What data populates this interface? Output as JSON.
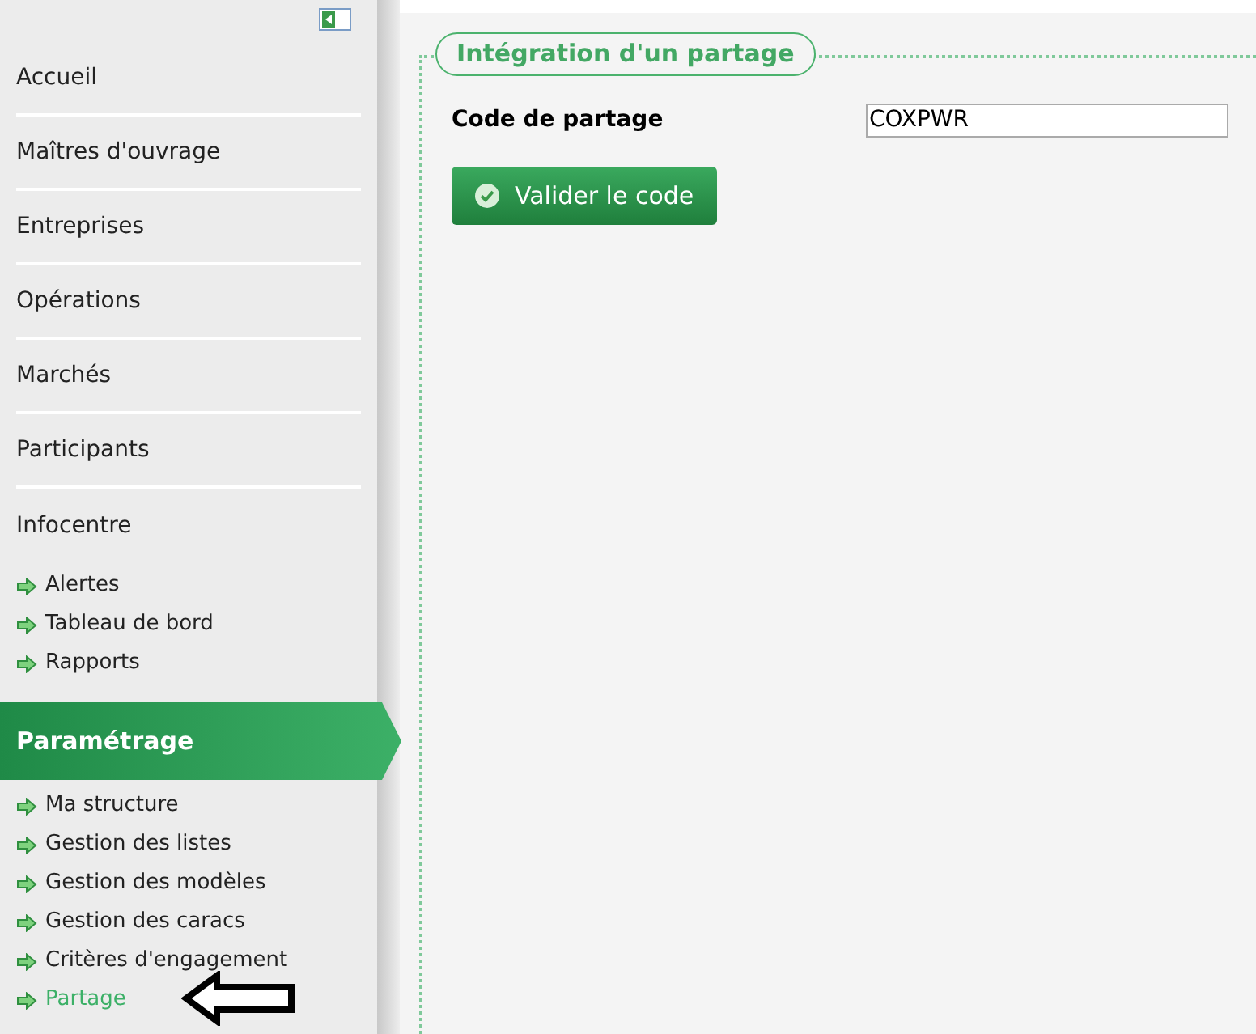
{
  "sidebar": {
    "items": [
      {
        "kind": "section",
        "label": "Accueil",
        "selected": false
      },
      {
        "kind": "section",
        "label": "Maîtres d'ouvrage",
        "selected": false
      },
      {
        "kind": "section",
        "label": "Entreprises",
        "selected": false
      },
      {
        "kind": "section",
        "label": "Opérations",
        "selected": false
      },
      {
        "kind": "section",
        "label": "Marchés",
        "selected": false
      },
      {
        "kind": "section",
        "label": "Participants",
        "selected": false
      },
      {
        "kind": "section",
        "label": "Infocentre",
        "selected": false,
        "children": [
          {
            "label": "Alertes",
            "selected": false
          },
          {
            "label": "Tableau de bord",
            "selected": false
          },
          {
            "label": "Rapports",
            "selected": false
          }
        ]
      },
      {
        "kind": "section",
        "label": "Paramétrage",
        "selected": true,
        "children": [
          {
            "label": "Ma structure",
            "selected": false
          },
          {
            "label": "Gestion des listes",
            "selected": false
          },
          {
            "label": "Gestion des modèles",
            "selected": false
          },
          {
            "label": "Gestion des caracs",
            "selected": false
          },
          {
            "label": "Critères d'engagement",
            "selected": false
          },
          {
            "label": "Partage",
            "selected": true
          }
        ]
      }
    ]
  },
  "annotation": {
    "kind": "arrow"
  },
  "form": {
    "legend": "Intégration d'un partage",
    "field": {
      "label": "Code de partage",
      "value": "COXPWR"
    },
    "button": "Valider le code"
  }
}
